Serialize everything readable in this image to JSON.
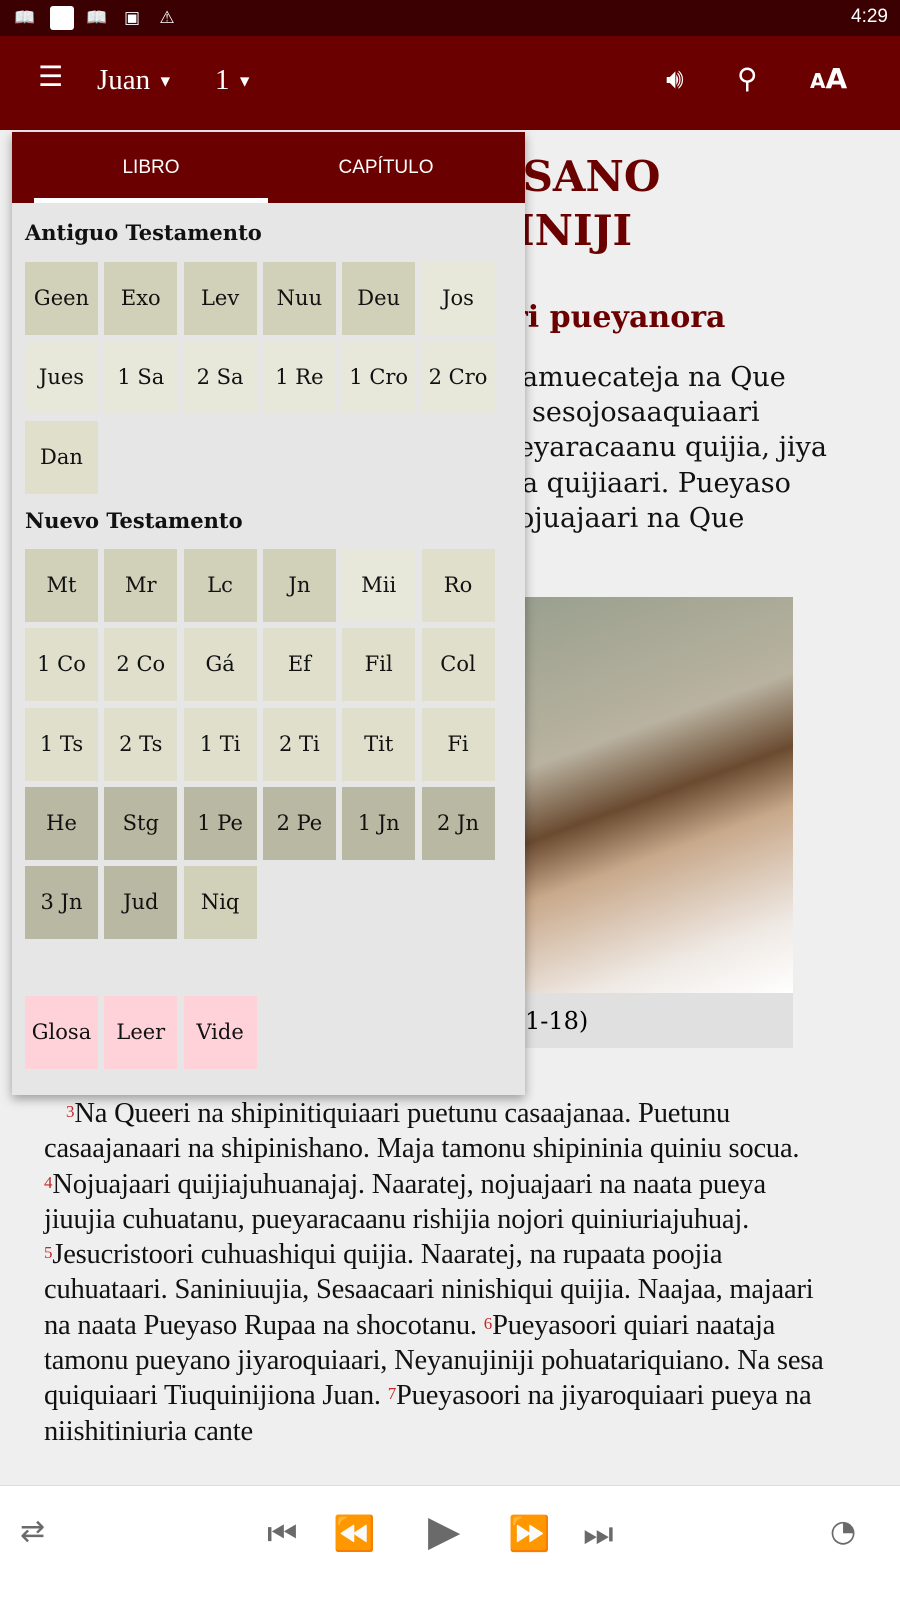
{
  "status_bar": {
    "time": "4:29",
    "icons": [
      "bible-icon",
      "blank-notification-icon",
      "bible-icon",
      "image-icon",
      "warning-icon"
    ]
  },
  "app_bar": {
    "book": "Juan",
    "chapter": "1",
    "icons": [
      "menu-icon",
      "volume-icon",
      "search-icon",
      "font-size-icon"
    ]
  },
  "background": {
    "title_line1": "ASANO",
    "title_line2": "INIJI",
    "subtitle": "ri pueyanora",
    "intro_lines": [
      "amuecateja na Que",
      "sesojosaaquiaari",
      "eyaracaanu quijia, jiya",
      "a quijiaari. Pueyaso",
      "ojuajaari na Que"
    ],
    "caption": "1-18)",
    "verses": [
      {
        "n": "3",
        "text": "Na Queeri na shipinitiquiaari puetunu casaajanaa. Puetunu casaajanaari na shipinishano. Maja tamonu shipininia quiniu socua. "
      },
      {
        "n": "4",
        "text": "Nojuajaari quijiajuhuanajaj. Naaratej, nojuajaari na naata pueya jiuujia cuhuatanu, pueyaracaanu rishijia nojori quiniuriajuhuaj. "
      },
      {
        "n": "5",
        "text": "Jesucristoori cuhuashiqui quijia. Naaratej, na rupaata poojia cuhuataari. Saniniuujia, Sesaacaari ninishiqui quijia. Naajaa, majaari na naata Pueyaso Rupaa na shocotanu. "
      },
      {
        "n": "6",
        "text": "Pueyasoori quiari naataja tamonu pueyano jiyaroquiaari, Neyanujiniji pohuatariquiano. Na sesa quiquiaari Tiuquinijiona Juan. "
      },
      {
        "n": "7",
        "text": "Pueyasoori na jiyaroquiaari pueya na niishitiniuria cante"
      }
    ]
  },
  "popup": {
    "tabs": [
      {
        "label": "LIBRO",
        "active": true
      },
      {
        "label": "CAPÍTULO",
        "active": false
      }
    ],
    "old_testament_label": "Antiguo Testamento",
    "old_testament": [
      {
        "label": "Geen",
        "shade": "m"
      },
      {
        "label": "Exo",
        "shade": "m"
      },
      {
        "label": "Lev",
        "shade": "m"
      },
      {
        "label": "Nuu",
        "shade": "m"
      },
      {
        "label": "Deu",
        "shade": "m"
      },
      {
        "label": "Jos",
        "shade": "vl"
      },
      {
        "label": "Jues",
        "shade": "vl"
      },
      {
        "label": "1 Sa",
        "shade": "vl"
      },
      {
        "label": "2 Sa",
        "shade": "vl"
      },
      {
        "label": "1 Re",
        "shade": "vl"
      },
      {
        "label": "1 Cro",
        "shade": "vl"
      },
      {
        "label": "2 Cro",
        "shade": "vl"
      },
      {
        "label": "Dan",
        "shade": "l"
      }
    ],
    "new_testament_label": "Nuevo Testamento",
    "new_testament": [
      {
        "label": "Mt",
        "shade": "m"
      },
      {
        "label": "Mr",
        "shade": "m"
      },
      {
        "label": "Lc",
        "shade": "m"
      },
      {
        "label": "Jn",
        "shade": "m"
      },
      {
        "label": "Mii",
        "shade": "vl"
      },
      {
        "label": "Ro",
        "shade": "l"
      },
      {
        "label": "1 Co",
        "shade": "l"
      },
      {
        "label": "2 Co",
        "shade": "l"
      },
      {
        "label": "Gá",
        "shade": "l"
      },
      {
        "label": "Ef",
        "shade": "l"
      },
      {
        "label": "Fil",
        "shade": "l"
      },
      {
        "label": "Col",
        "shade": "l"
      },
      {
        "label": "1 Ts",
        "shade": "l"
      },
      {
        "label": "2 Ts",
        "shade": "l"
      },
      {
        "label": "1 Ti",
        "shade": "l"
      },
      {
        "label": "2 Ti",
        "shade": "l"
      },
      {
        "label": "Tit",
        "shade": "l"
      },
      {
        "label": "Fi",
        "shade": "l"
      },
      {
        "label": "He",
        "shade": "d"
      },
      {
        "label": "Stg",
        "shade": "d"
      },
      {
        "label": "1 Pe",
        "shade": "d"
      },
      {
        "label": "2 Pe",
        "shade": "d"
      },
      {
        "label": "1 Jn",
        "shade": "d"
      },
      {
        "label": "2 Jn",
        "shade": "d"
      },
      {
        "label": "3 Jn",
        "shade": "d"
      },
      {
        "label": "Jud",
        "shade": "d"
      },
      {
        "label": "Niq",
        "shade": "m"
      }
    ],
    "extras": [
      {
        "label": "Glosa"
      },
      {
        "label": "Leer"
      },
      {
        "label": "Vide"
      }
    ]
  },
  "player": {
    "icons": [
      "repeat-icon",
      "skip-previous-icon",
      "rewind-icon",
      "play-icon",
      "fast-forward-icon",
      "skip-next-icon",
      "speed-icon"
    ]
  },
  "colors": {
    "primary": "#6b0000",
    "status_bar": "#3a0002",
    "verse_number": "#c62828",
    "extra_tile": "#ffd1d9"
  }
}
